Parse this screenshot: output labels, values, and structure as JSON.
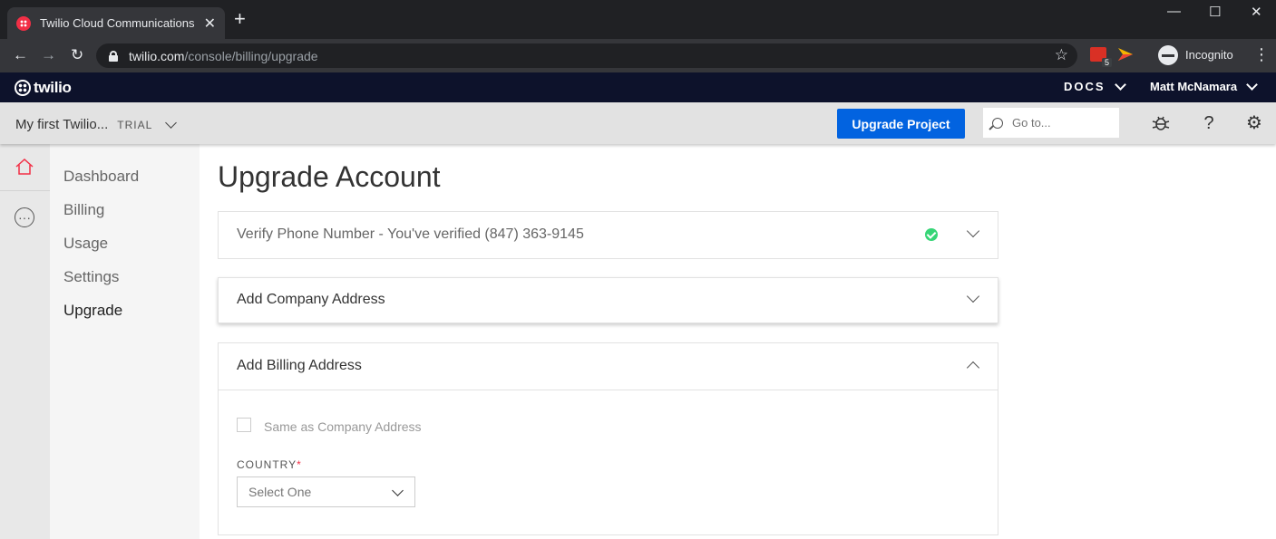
{
  "browser": {
    "tab_title": "Twilio Cloud Communications | W",
    "url_host": "twilio.com",
    "url_path": "/console/billing/upgrade",
    "extension_badge": "5",
    "incognito_label": "Incognito"
  },
  "nav": {
    "brand": "twilio",
    "docs_label": "DOCS",
    "user_name": "Matt McNamara"
  },
  "project": {
    "name": "My first Twilio...",
    "plan": "TRIAL",
    "upgrade_label": "Upgrade Project",
    "search_placeholder": "Go to..."
  },
  "sidebar": {
    "items": [
      {
        "label": "Dashboard",
        "active": false
      },
      {
        "label": "Billing",
        "active": false
      },
      {
        "label": "Usage",
        "active": false
      },
      {
        "label": "Settings",
        "active": false
      },
      {
        "label": "Upgrade",
        "active": true
      }
    ]
  },
  "main": {
    "title": "Upgrade Account",
    "panels": [
      {
        "title": "Verify Phone Number - You've verified (847) 363-9145",
        "state": "complete"
      },
      {
        "title": "Add Company Address",
        "state": "collapsed"
      },
      {
        "title": "Add Billing Address",
        "state": "expanded"
      }
    ],
    "billing": {
      "same_as_label": "Same as Company Address",
      "country_label": "COUNTRY",
      "required_mark": "*",
      "country_value": "Select One"
    }
  },
  "colors": {
    "nav_bg": "#0d122b",
    "primary": "#0263e0",
    "success": "#36d576",
    "brand_red": "#f22f46"
  }
}
